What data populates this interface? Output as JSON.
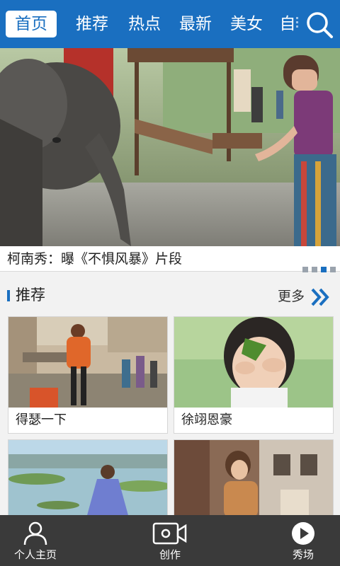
{
  "top_nav": {
    "tabs": [
      {
        "label": "首页",
        "active": true
      },
      {
        "label": "推荐"
      },
      {
        "label": "热点"
      },
      {
        "label": "最新"
      },
      {
        "label": "美女"
      },
      {
        "label": "自"
      }
    ],
    "search_icon": "search-icon"
  },
  "banner": {
    "caption": "柯南秀：曝《不惧风暴》片段",
    "slide_count": 4,
    "active_slide": 3
  },
  "recommend": {
    "title": "推荐",
    "more_label": "更多",
    "more_icon": "double-chevron-right-icon",
    "items": [
      {
        "label": "得瑟一下"
      },
      {
        "label": "徐翊恩豪"
      },
      {
        "label": ""
      },
      {
        "label": ""
      }
    ]
  },
  "bottom_nav": {
    "items": [
      {
        "label": "个人主页",
        "icon": "user-icon"
      },
      {
        "label": "创作",
        "icon": "video-camera-icon"
      },
      {
        "label": "秀场",
        "icon": "play-circle-icon"
      }
    ]
  },
  "colors": {
    "accent": "#1a6fc0",
    "bottom_bar": "#3a3a3a",
    "background": "#f2f2f2"
  }
}
